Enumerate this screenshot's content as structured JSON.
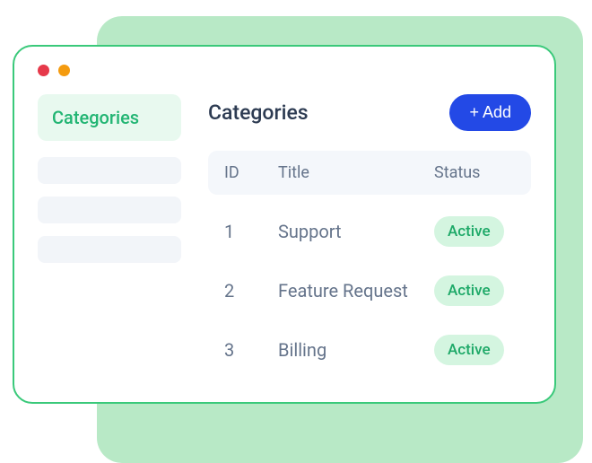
{
  "sidebar": {
    "active_label": "Categories"
  },
  "page": {
    "title": "Categories",
    "add_button": "+ Add"
  },
  "table": {
    "headers": {
      "id": "ID",
      "title": "Title",
      "status": "Status"
    },
    "rows": [
      {
        "id": "1",
        "title": "Support",
        "status": "Active"
      },
      {
        "id": "2",
        "title": "Feature Request",
        "status": "Active"
      },
      {
        "id": "3",
        "title": "Billing",
        "status": "Active"
      }
    ]
  }
}
